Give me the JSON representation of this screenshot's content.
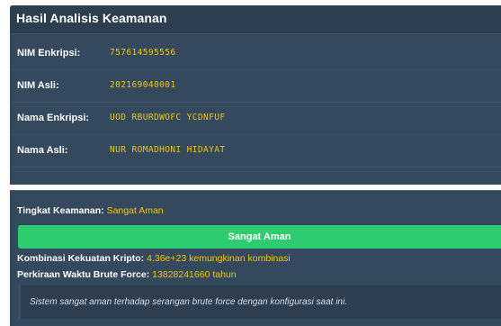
{
  "panel": {
    "title": "Hasil Analisis Keamanan",
    "rows": [
      {
        "label": "NIM Enkripsi:",
        "value": "757614595556"
      },
      {
        "label": "NIM Asli:",
        "value": "202169040001"
      },
      {
        "label": "Nama Enkripsi:",
        "value": "UOD RBURDWOFC YCDNFUF"
      },
      {
        "label": "Nama Asli:",
        "value": "NUR ROMADHONI HIDAYAT"
      }
    ]
  },
  "security": {
    "level_label": "Tingkat Keamanan:",
    "level_value": "Sangat Aman",
    "bar_label": "Sangat Aman",
    "combination_label": "Kombinasi Kekuatan Kripto:",
    "combination_value": "4.36e+23 kemungkinan kombinasi",
    "bruteforce_label": "Perkiraan Waktu Brute Force:",
    "bruteforce_value": "13828241660 tahun",
    "note": "Sistem sangat aman terhadap serangan brute force dengan konfigurasi saat ini."
  },
  "colors": {
    "panel_bg": "#34495e",
    "header_bg": "#2c3e50",
    "accent_yellow": "#f1c40f",
    "success_green": "#2ecc71"
  }
}
